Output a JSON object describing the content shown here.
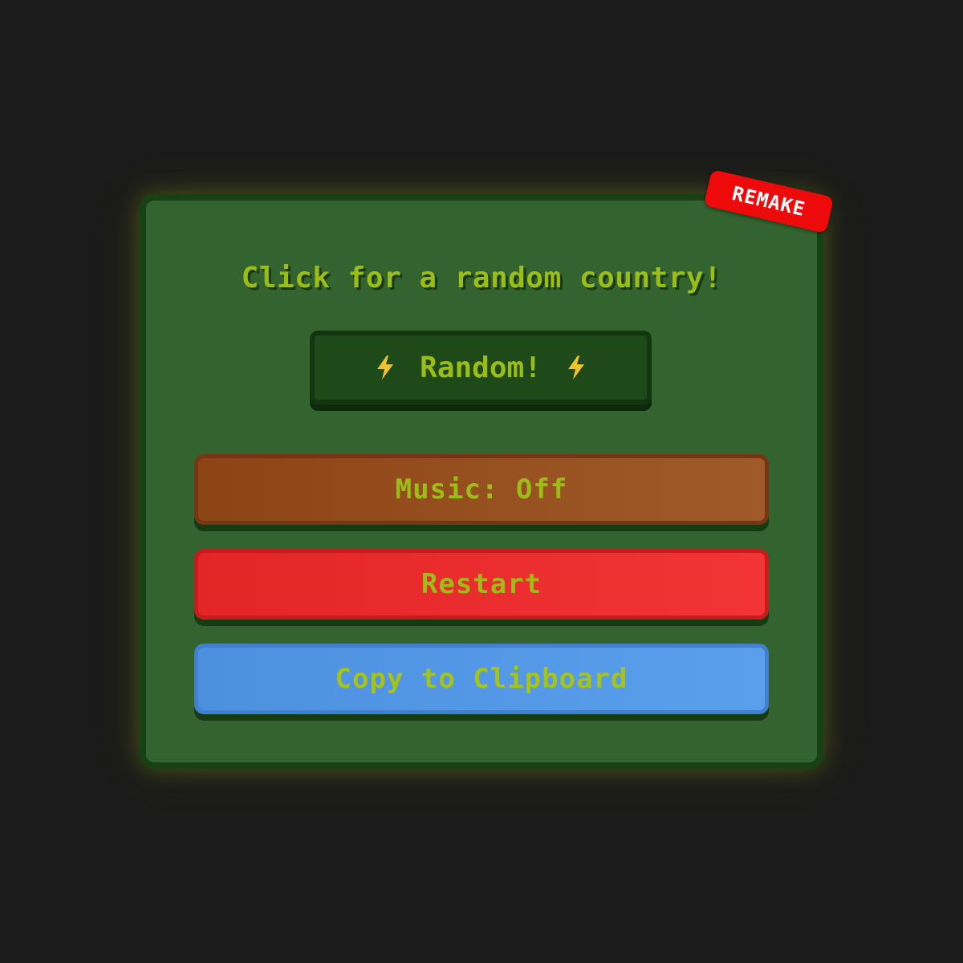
{
  "panel": {
    "badge": "REMAKE",
    "headline": "Click for a random country!",
    "random_button": {
      "label": "Random!",
      "icon": "lightning-bolt-icon"
    },
    "buttons": {
      "music": "Music: Off",
      "restart": "Restart",
      "copy": "Copy to Clipboard"
    }
  },
  "colors": {
    "background": "#1b1b1b",
    "panel": "#33632f",
    "panel_border": "#174015",
    "text_accent": "#9cbd18",
    "badge": "#ee0a0a",
    "music_button": "#9a5220",
    "restart_button": "#ec2c2c",
    "copy_button": "#5398e6",
    "bolt": "#f2c12e"
  }
}
